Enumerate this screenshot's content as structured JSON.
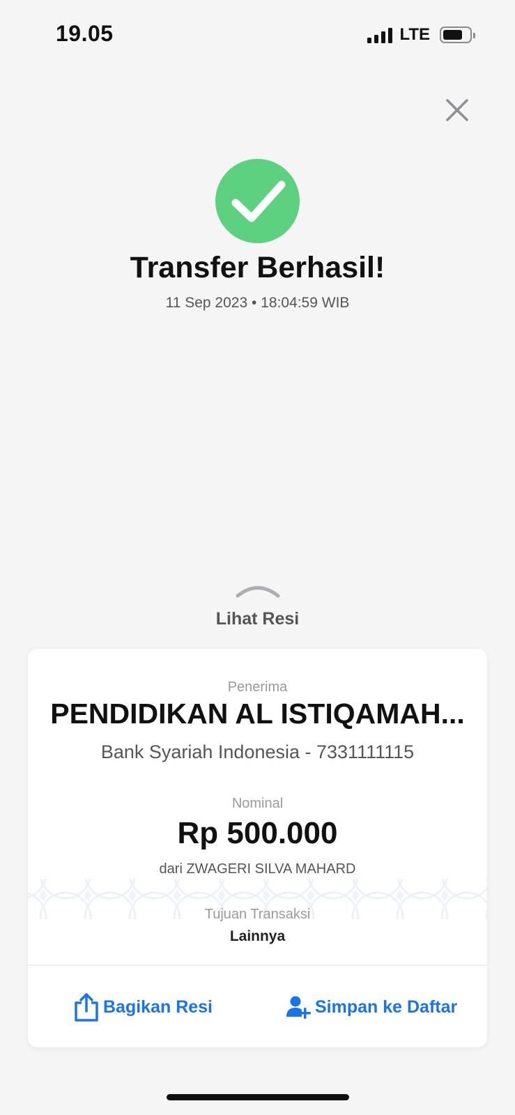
{
  "status_bar": {
    "time": "19.05",
    "network": "LTE"
  },
  "success": {
    "title": "Transfer Berhasil!",
    "timestamp": "11 Sep 2023 • 18:04:59 WIB"
  },
  "receipt_toggle": {
    "label": "Lihat Resi"
  },
  "receipt": {
    "recipient_label": "Penerima",
    "recipient_name": "PENDIDIKAN AL ISTIQAMAH...",
    "recipient_bank": "Bank Syariah Indonesia - 7331111115",
    "amount_label": "Nominal",
    "amount": "Rp 500.000",
    "sender": "dari ZWAGERI SILVA MAHARD",
    "purpose_label": "Tujuan Transaksi",
    "purpose": "Lainnya"
  },
  "actions": {
    "share_label": "Bagikan Resi",
    "save_label": "Simpan ke Daftar"
  },
  "colors": {
    "success_green": "#5dd17f",
    "action_blue": "#1a73e8",
    "background": "#f5f5f5"
  },
  "icons": {
    "close": "close-icon",
    "success": "checkmark-icon",
    "toggle": "chevron-up-icon",
    "share": "share-icon",
    "save": "add-user-icon"
  }
}
